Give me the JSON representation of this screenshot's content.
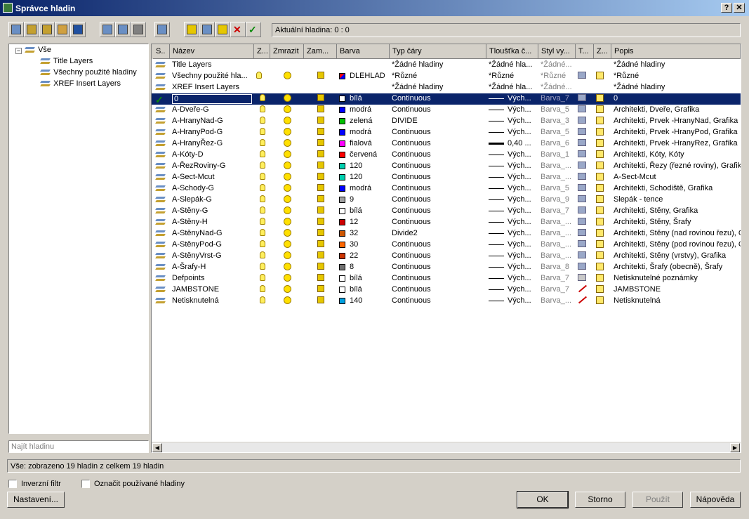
{
  "window": {
    "title": "Správce hladin",
    "help_btn": "?",
    "close_btn": "✕"
  },
  "toolbar": {
    "current_layer": "Aktuální hladina: 0 : 0",
    "buttons": [
      "new-filter-icon",
      "new-group-filter-icon",
      "layer-states-icon",
      "layer-settings-icon",
      "save-icon",
      "new-layer-icon",
      "new-layer-vp-icon",
      "delete-filter-icon",
      "refresh-icon",
      "new-layer2-icon",
      "new-layer-frozen-icon",
      "new-layer-all-icon",
      "delete-layer-icon",
      "set-current-icon"
    ]
  },
  "tree": {
    "root": "Vše",
    "expander": "−",
    "children": [
      "Title Layers",
      "Všechny použité hladiny",
      "XREF Insert Layers"
    ]
  },
  "search": {
    "placeholder": "Najít hladinu"
  },
  "columns": [
    "S..",
    "Název",
    "Z...",
    "Zmrazit",
    "Zam...",
    "Barva",
    "Typ čáry",
    "Tloušťka č...",
    "Styl vy...",
    "T...",
    "Z...",
    "Popis"
  ],
  "filter_rows": [
    {
      "name": "Title Layers",
      "color": "",
      "linetype": "*Žádné hladiny",
      "lineweight": "*Žádné hla...",
      "plotstyle": "*Žádné...",
      "desc": "*Žádné hladiny",
      "icons": false
    },
    {
      "name": "Všechny použité hla...",
      "color": "DLEHLAD",
      "linetype": "*Různé",
      "lineweight": "*Různé",
      "plotstyle": "*Různé",
      "desc": "*Různé",
      "icons": true
    },
    {
      "name": "XREF Insert Layers",
      "color": "",
      "linetype": "*Žádné hladiny",
      "lineweight": "*Žádné hla...",
      "plotstyle": "*Žádné...",
      "desc": "*Žádné hladiny",
      "icons": false
    }
  ],
  "layers": [
    {
      "name": "0",
      "swatch": "#ffffff",
      "color": "bílá",
      "linetype": "Continuous",
      "lineweight": "Vých...",
      "plotstyle": "Barva_7",
      "plot": "on",
      "desc": "0",
      "selected": true,
      "thick": false
    },
    {
      "name": "A-Dveře-G",
      "swatch": "#0000ff",
      "color": "modrá",
      "linetype": "Continuous",
      "lineweight": "Vých...",
      "plotstyle": "Barva_5",
      "plot": "on",
      "desc": "Architekti, Dveře, Grafika"
    },
    {
      "name": "A-HranyNad-G",
      "swatch": "#00c000",
      "color": "zelená",
      "linetype": "DIVIDE",
      "lineweight": "Vých...",
      "plotstyle": "Barva_3",
      "plot": "on",
      "desc": "Architekti, Prvek -HranyNad, Grafika"
    },
    {
      "name": "A-HranyPod-G",
      "swatch": "#0000ff",
      "color": "modrá",
      "linetype": "Continuous",
      "lineweight": "Vých...",
      "plotstyle": "Barva_5",
      "plot": "on",
      "desc": "Architekti, Prvek -HranyPod, Grafika"
    },
    {
      "name": "A-HranyŘez-G",
      "swatch": "#ff00ff",
      "color": "fialová",
      "linetype": "Continuous",
      "lineweight": "0,40 ...",
      "plotstyle": "Barva_6",
      "plot": "on",
      "desc": "Architekti, Prvek -HranyRez, Grafika",
      "thick": true
    },
    {
      "name": "A-Kóty-D",
      "swatch": "#ff0000",
      "color": "červená",
      "linetype": "Continuous",
      "lineweight": "Vých...",
      "plotstyle": "Barva_1",
      "plot": "on",
      "desc": "Architekti, Kóty, Kóty"
    },
    {
      "name": "A-ŘezRoviny-G",
      "swatch": "#00d0b0",
      "color": "120",
      "linetype": "Continuous",
      "lineweight": "Vých...",
      "plotstyle": "Barva_...",
      "plot": "on",
      "desc": "Architekti, Řezy (řezné roviny), Grafika"
    },
    {
      "name": "A-Sect-Mcut",
      "swatch": "#00d0b0",
      "color": "120",
      "linetype": "Continuous",
      "lineweight": "Vých...",
      "plotstyle": "Barva_...",
      "plot": "on",
      "desc": "A-Sect-Mcut"
    },
    {
      "name": "A-Schody-G",
      "swatch": "#0000ff",
      "color": "modrá",
      "linetype": "Continuous",
      "lineweight": "Vých...",
      "plotstyle": "Barva_5",
      "plot": "on",
      "desc": "Architekti, Schodiště, Grafika"
    },
    {
      "name": "A-Slepák-G",
      "swatch": "#a0a0a0",
      "color": "9",
      "linetype": "Continuous",
      "lineweight": "Vých...",
      "plotstyle": "Barva_9",
      "plot": "on",
      "desc": "Slepák - tence"
    },
    {
      "name": "A-Stěny-G",
      "swatch": "#ffffff",
      "color": "bílá",
      "linetype": "Continuous",
      "lineweight": "Vých...",
      "plotstyle": "Barva_7",
      "plot": "on",
      "desc": "Architekti, Stěny, Grafika"
    },
    {
      "name": "A-Stěny-H",
      "swatch": "#cc0000",
      "color": "12",
      "linetype": "Continuous",
      "lineweight": "Vých...",
      "plotstyle": "Barva_...",
      "plot": "on",
      "desc": "Architekti, Stěny, Šrafy"
    },
    {
      "name": "A-StěnyNad-G",
      "swatch": "#cc5500",
      "color": "32",
      "linetype": "Divide2",
      "lineweight": "Vých...",
      "plotstyle": "Barva_...",
      "plot": "on",
      "desc": "Architekti, Stěny (nad rovinou řezu), G"
    },
    {
      "name": "A-StěnyPod-G",
      "swatch": "#ff6600",
      "color": "30",
      "linetype": "Continuous",
      "lineweight": "Vých...",
      "plotstyle": "Barva_...",
      "plot": "on",
      "desc": "Architekti, Stěny (pod rovinou řezu), G"
    },
    {
      "name": "A-StěnyVrst-G",
      "swatch": "#cc3300",
      "color": "22",
      "linetype": "Continuous",
      "lineweight": "Vých...",
      "plotstyle": "Barva_...",
      "plot": "on",
      "desc": "Architekti, Stěny (vrstvy), Grafika"
    },
    {
      "name": "A-Šrafy-H",
      "swatch": "#707070",
      "color": "8",
      "linetype": "Continuous",
      "lineweight": "Vých...",
      "plotstyle": "Barva_8",
      "plot": "on",
      "desc": "Architekti, Šrafy (obecně), Šrafy"
    },
    {
      "name": "Defpoints",
      "swatch": "#ffffff",
      "color": "bílá",
      "linetype": "Continuous",
      "lineweight": "Vých...",
      "plotstyle": "Barva_7",
      "plot": "off",
      "desc": "Netisknutelné poznámky"
    },
    {
      "name": "JAMBSTONE",
      "swatch": "#ffffff",
      "color": "bílá",
      "linetype": "Continuous",
      "lineweight": "Vých...",
      "plotstyle": "Barva_7",
      "plot": "none",
      "desc": "JAMBSTONE"
    },
    {
      "name": "Netisknutelná",
      "swatch": "#00a0e0",
      "color": "140",
      "linetype": "Continuous",
      "lineweight": "Vých...",
      "plotstyle": "Barva_...",
      "plot": "none",
      "desc": "Netisknutelná"
    }
  ],
  "status": "Vše: zobrazeno 19 hladin z celkem 19 hladin",
  "checkboxes": {
    "invert": "Inverzní filtr",
    "mark_used": "Označit používané hladiny"
  },
  "buttons": {
    "settings": "Nastavení...",
    "ok": "OK",
    "cancel": "Storno",
    "apply": "Použít",
    "help": "Nápověda"
  }
}
